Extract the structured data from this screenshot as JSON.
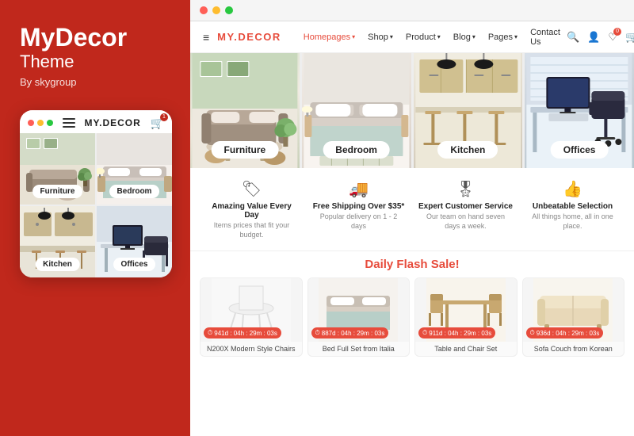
{
  "left": {
    "brand": "MyDecor",
    "theme_label": "Theme",
    "by": "By skygroup",
    "mobile_dots": [
      "#ff5f57",
      "#febc2e",
      "#28c840"
    ],
    "mobile_brand": "MY.DECOR",
    "mobile_cart_badge": "1",
    "mobile_categories": [
      {
        "id": "furniture",
        "label": "Furniture"
      },
      {
        "id": "bedroom",
        "label": "Bedroom"
      },
      {
        "id": "kitchen",
        "label": "Kitchen"
      },
      {
        "id": "offices",
        "label": "Offices"
      }
    ]
  },
  "browser": {
    "dots": [
      "#ff5f57",
      "#febc2e",
      "#28c840"
    ]
  },
  "nav": {
    "hamburger": "≡",
    "brand_prefix": "MY.",
    "brand_suffix": "DECOR",
    "links": [
      {
        "label": "Homepages",
        "has_arrow": true
      },
      {
        "label": "Shop",
        "has_arrow": true
      },
      {
        "label": "Product",
        "has_arrow": true
      },
      {
        "label": "Blog",
        "has_arrow": true
      },
      {
        "label": "Pages",
        "has_arrow": true
      },
      {
        "label": "Contact Us",
        "has_arrow": false
      }
    ],
    "search_badge": "0",
    "cart_badge": "0",
    "wishlist_badge": "0"
  },
  "hero": {
    "categories": [
      {
        "id": "furniture",
        "label": "Furniture"
      },
      {
        "id": "bedroom",
        "label": "Bedroom"
      },
      {
        "id": "kitchen",
        "label": "Kitchen"
      },
      {
        "id": "offices",
        "label": "Offices"
      }
    ]
  },
  "features": [
    {
      "icon": "🏷",
      "title": "Amazing Value Every Day",
      "desc": "Items prices that fit your budget."
    },
    {
      "icon": "🚚",
      "title": "Free Shipping Over $35*",
      "desc": "Popular delivery on 1 - 2 days"
    },
    {
      "icon": "🎖",
      "title": "Expert Customer Service",
      "desc": "Our team on hand seven days a week."
    },
    {
      "icon": "👍",
      "title": "Unbeatable Selection",
      "desc": "All things home, all in one place."
    }
  ],
  "flash_sale": {
    "title": "Daily Flash Sale!",
    "products": [
      {
        "name": "N200X Modern Style Chairs",
        "timer": "941d : 04h : 29m : 03s",
        "color": "#f5f5f5"
      },
      {
        "name": "Bed Full Set from Italia",
        "timer": "887d : 04h : 29m : 03s",
        "color": "#f0ede8"
      },
      {
        "name": "Table and Chair Set",
        "timer": "911d : 04h : 29m : 03s",
        "color": "#f5f0e8"
      },
      {
        "name": "Sofa Couch from Korean",
        "timer": "936d : 04h : 29m : 03s",
        "color": "#f8f5ee"
      }
    ]
  }
}
